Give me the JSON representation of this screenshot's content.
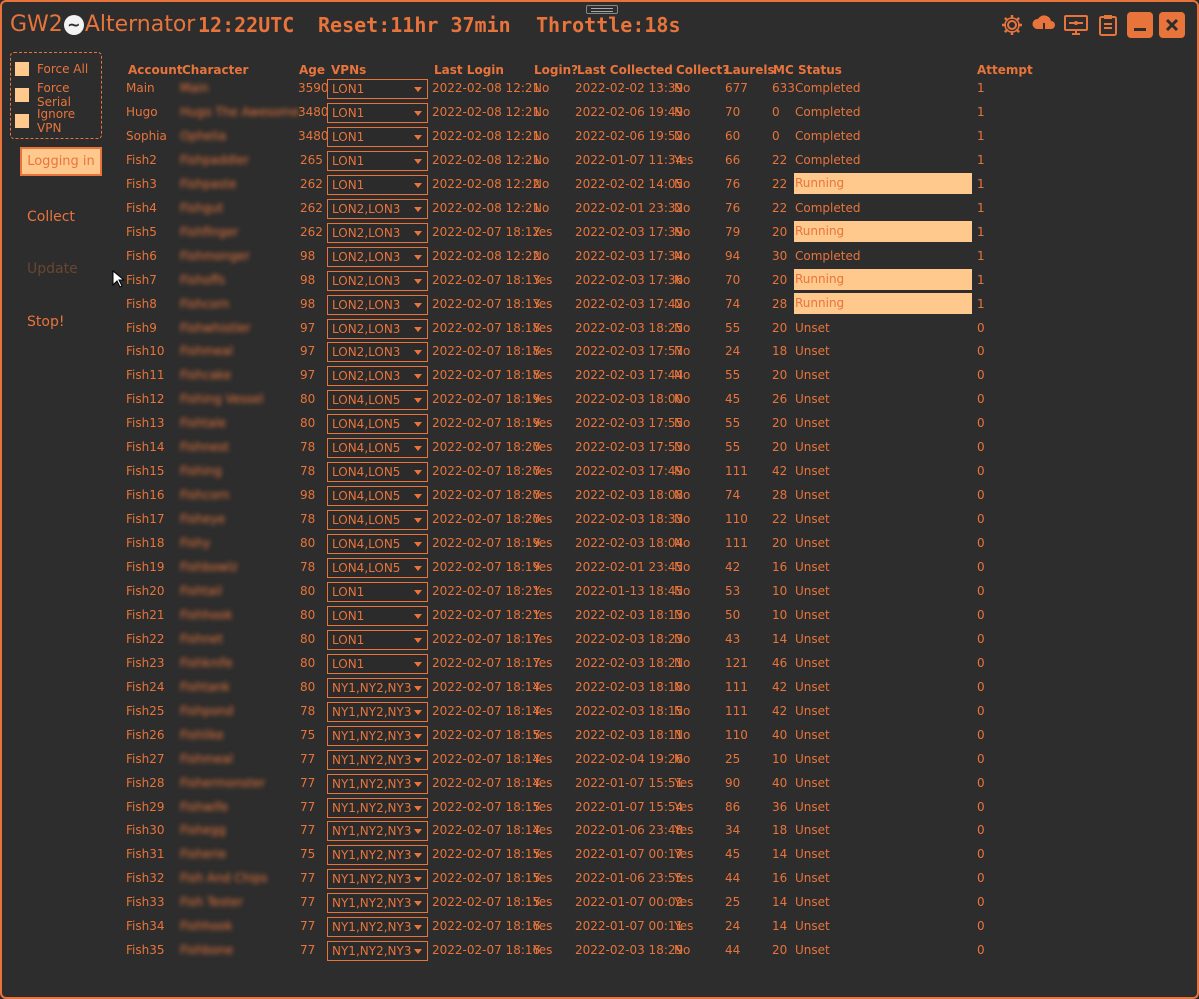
{
  "app": {
    "title_left": "GW2",
    "logo_glyph": "~",
    "title_right": "Alternator",
    "time": "12:22UTC",
    "reset_label": "Reset:",
    "reset_value": "11hr 37min",
    "throttle_label": "Throttle:",
    "throttle_value": "18s"
  },
  "top_icons": [
    "gear-icon",
    "cloud-download-icon",
    "monitor-icon",
    "clipboard-icon",
    "minimize-icon",
    "close-icon"
  ],
  "options": [
    {
      "label": "Force All",
      "checked": false
    },
    {
      "label": "Force Serial",
      "checked": false
    },
    {
      "label": "Ignore VPN",
      "checked": false
    }
  ],
  "buttons": {
    "logging": "Logging in",
    "collect": "Collect",
    "update": "Update",
    "stop": "Stop!"
  },
  "columns": {
    "account": "Account",
    "character": "Character",
    "age": "Age",
    "vpns": "VPNs",
    "last_login": "Last Login",
    "login": "Login?",
    "last_collected": "Last Collected",
    "collect": "Collect?",
    "laurels": "Laurels",
    "mc": "MC",
    "status": "Status",
    "attempt": "Attempt"
  },
  "rows": [
    [
      "Main",
      "Main",
      "3590",
      "LON1",
      "2022-02-08 12:21",
      "No",
      "2022-02-02 13:39",
      "No",
      "677",
      "633",
      "Completed",
      "1"
    ],
    [
      "Hugo",
      "Hugo The Awesome",
      "3480",
      "LON1",
      "2022-02-08 12:21",
      "No",
      "2022-02-06 19:49",
      "No",
      "70",
      "0",
      "Completed",
      "1"
    ],
    [
      "Sophia",
      "Ophelia",
      "3480",
      "LON1",
      "2022-02-08 12:21",
      "No",
      "2022-02-06 19:52",
      "No",
      "60",
      "0",
      "Completed",
      "1"
    ],
    [
      "Fish2",
      "Fishpaddler",
      "265",
      "LON1",
      "2022-02-08 12:21",
      "No",
      "2022-01-07 11:34",
      "Yes",
      "66",
      "22",
      "Completed",
      "1"
    ],
    [
      "Fish3",
      "Fishpaste",
      "262",
      "LON1",
      "2022-02-08 12:22",
      "No",
      "2022-02-02 14:05",
      "No",
      "76",
      "22",
      "Running",
      "1"
    ],
    [
      "Fish4",
      "Fishgut",
      "262",
      "LON2,LON3",
      "2022-02-08 12:21",
      "No",
      "2022-02-01 23:32",
      "No",
      "76",
      "22",
      "Completed",
      "1"
    ],
    [
      "Fish5",
      "Fishfinger",
      "262",
      "LON2,LON3",
      "2022-02-07 18:12",
      "Yes",
      "2022-02-03 17:39",
      "No",
      "79",
      "20",
      "Running",
      "1"
    ],
    [
      "Fish6",
      "Fishmonger",
      "98",
      "LON2,LON3",
      "2022-02-08 12:22",
      "No",
      "2022-02-03 17:34",
      "No",
      "94",
      "30",
      "Completed",
      "1"
    ],
    [
      "Fish7",
      "Fishoffs",
      "98",
      "LON2,LON3",
      "2022-02-07 18:13",
      "Yes",
      "2022-02-03 17:36",
      "No",
      "70",
      "20",
      "Running",
      "1"
    ],
    [
      "Fish8",
      "Fishcorn",
      "98",
      "LON2,LON3",
      "2022-02-07 18:13",
      "Yes",
      "2022-02-03 17:42",
      "No",
      "74",
      "28",
      "Running",
      "1"
    ],
    [
      "Fish9",
      "Fishwhistler",
      "97",
      "LON2,LON3",
      "2022-02-07 18:18",
      "Yes",
      "2022-02-03 18:25",
      "No",
      "55",
      "20",
      "Unset",
      "0"
    ],
    [
      "Fish10",
      "Fishmeal",
      "97",
      "LON2,LON3",
      "2022-02-07 18:18",
      "Yes",
      "2022-02-03 17:57",
      "No",
      "24",
      "18",
      "Unset",
      "0"
    ],
    [
      "Fish11",
      "Fishcake",
      "97",
      "LON2,LON3",
      "2022-02-07 18:18",
      "Yes",
      "2022-02-03 17:44",
      "No",
      "55",
      "20",
      "Unset",
      "0"
    ],
    [
      "Fish12",
      "Fishing Vessel",
      "80",
      "LON4,LON5",
      "2022-02-07 18:19",
      "Yes",
      "2022-02-03 18:00",
      "No",
      "45",
      "26",
      "Unset",
      "0"
    ],
    [
      "Fish13",
      "Fishtale",
      "80",
      "LON4,LON5",
      "2022-02-07 18:19",
      "Yes",
      "2022-02-03 17:55",
      "No",
      "55",
      "20",
      "Unset",
      "0"
    ],
    [
      "Fish14",
      "Fishnest",
      "78",
      "LON4,LON5",
      "2022-02-07 18:20",
      "Yes",
      "2022-02-03 17:53",
      "No",
      "55",
      "20",
      "Unset",
      "0"
    ],
    [
      "Fish15",
      "Fishing",
      "78",
      "LON4,LON5",
      "2022-02-07 18:20",
      "Yes",
      "2022-02-03 17:49",
      "No",
      "111",
      "42",
      "Unset",
      "0"
    ],
    [
      "Fish16",
      "Fishcorn",
      "98",
      "LON4,LON5",
      "2022-02-07 18:20",
      "Yes",
      "2022-02-03 18:08",
      "No",
      "74",
      "28",
      "Unset",
      "0"
    ],
    [
      "Fish17",
      "Fisheye",
      "78",
      "LON4,LON5",
      "2022-02-07 18:20",
      "Yes",
      "2022-02-03 18:33",
      "No",
      "110",
      "22",
      "Unset",
      "0"
    ],
    [
      "Fish18",
      "Fishy",
      "80",
      "LON4,LON5",
      "2022-02-07 18:19",
      "Yes",
      "2022-02-03 18:04",
      "No",
      "111",
      "20",
      "Unset",
      "0"
    ],
    [
      "Fish19",
      "Fishbowlz",
      "78",
      "LON4,LON5",
      "2022-02-07 18:19",
      "Yes",
      "2022-02-01 23:45",
      "No",
      "42",
      "16",
      "Unset",
      "0"
    ],
    [
      "Fish20",
      "Fishtail",
      "80",
      "LON1",
      "2022-02-07 18:21",
      "Yes",
      "2022-01-13 18:45",
      "No",
      "53",
      "10",
      "Unset",
      "0"
    ],
    [
      "Fish21",
      "Fishhook",
      "80",
      "LON1",
      "2022-02-07 18:21",
      "Yes",
      "2022-02-03 18:13",
      "No",
      "50",
      "10",
      "Unset",
      "0"
    ],
    [
      "Fish22",
      "Fishnet",
      "80",
      "LON1",
      "2022-02-07 18:17",
      "Yes",
      "2022-02-03 18:23",
      "No",
      "43",
      "14",
      "Unset",
      "0"
    ],
    [
      "Fish23",
      "Fishknife",
      "80",
      "LON1",
      "2022-02-07 18:17",
      "Yes",
      "2022-02-03 18:21",
      "No",
      "121",
      "46",
      "Unset",
      "0"
    ],
    [
      "Fish24",
      "Fishtank",
      "80",
      "NY1,NY2,NY3",
      "2022-02-07 18:14",
      "Yes",
      "2022-02-03 18:18",
      "No",
      "111",
      "42",
      "Unset",
      "0"
    ],
    [
      "Fish25",
      "Fishpond",
      "78",
      "NY1,NY2,NY3",
      "2022-02-07 18:14",
      "Yes",
      "2022-02-03 18:15",
      "No",
      "111",
      "42",
      "Unset",
      "0"
    ],
    [
      "Fish26",
      "Fishlike",
      "75",
      "NY1,NY2,NY3",
      "2022-02-07 18:15",
      "Yes",
      "2022-02-03 18:11",
      "No",
      "110",
      "40",
      "Unset",
      "0"
    ],
    [
      "Fish27",
      "Fishmeal",
      "77",
      "NY1,NY2,NY3",
      "2022-02-07 18:14",
      "Yes",
      "2022-02-04 19:26",
      "No",
      "25",
      "10",
      "Unset",
      "0"
    ],
    [
      "Fish28",
      "Fishermonster",
      "77",
      "NY1,NY2,NY3",
      "2022-02-07 18:14",
      "Yes",
      "2022-01-07 15:51",
      "Yes",
      "90",
      "40",
      "Unset",
      "0"
    ],
    [
      "Fish29",
      "Fishwife",
      "77",
      "NY1,NY2,NY3",
      "2022-02-07 18:15",
      "Yes",
      "2022-01-07 15:54",
      "Yes",
      "86",
      "36",
      "Unset",
      "0"
    ],
    [
      "Fish30",
      "Fishegg",
      "77",
      "NY1,NY2,NY3",
      "2022-02-07 18:14",
      "Yes",
      "2022-01-06 23:48",
      "Yes",
      "34",
      "18",
      "Unset",
      "0"
    ],
    [
      "Fish31",
      "Fisherie",
      "75",
      "NY1,NY2,NY3",
      "2022-02-07 18:15",
      "Yes",
      "2022-01-07 00:17",
      "Yes",
      "45",
      "14",
      "Unset",
      "0"
    ],
    [
      "Fish32",
      "Fish And Chips",
      "77",
      "NY1,NY2,NY3",
      "2022-02-07 18:15",
      "Yes",
      "2022-01-06 23:55",
      "Yes",
      "44",
      "16",
      "Unset",
      "0"
    ],
    [
      "Fish33",
      "Fish Tester",
      "77",
      "NY1,NY2,NY3",
      "2022-02-07 18:15",
      "Yes",
      "2022-01-07 00:02",
      "Yes",
      "25",
      "14",
      "Unset",
      "0"
    ],
    [
      "Fish34",
      "Fishhook",
      "77",
      "NY1,NY2,NY3",
      "2022-02-07 18:16",
      "Yes",
      "2022-01-07 00:11",
      "Yes",
      "24",
      "14",
      "Unset",
      "0"
    ],
    [
      "Fish35",
      "Fishbone",
      "77",
      "NY1,NY2,NY3",
      "2022-02-07 18:16",
      "Yes",
      "2022-02-03 18:29",
      "No",
      "44",
      "20",
      "Unset",
      "0"
    ]
  ],
  "colors": {
    "accent": "#e8743b",
    "highlight": "#ffc98e",
    "background": "#2d2d2d"
  }
}
